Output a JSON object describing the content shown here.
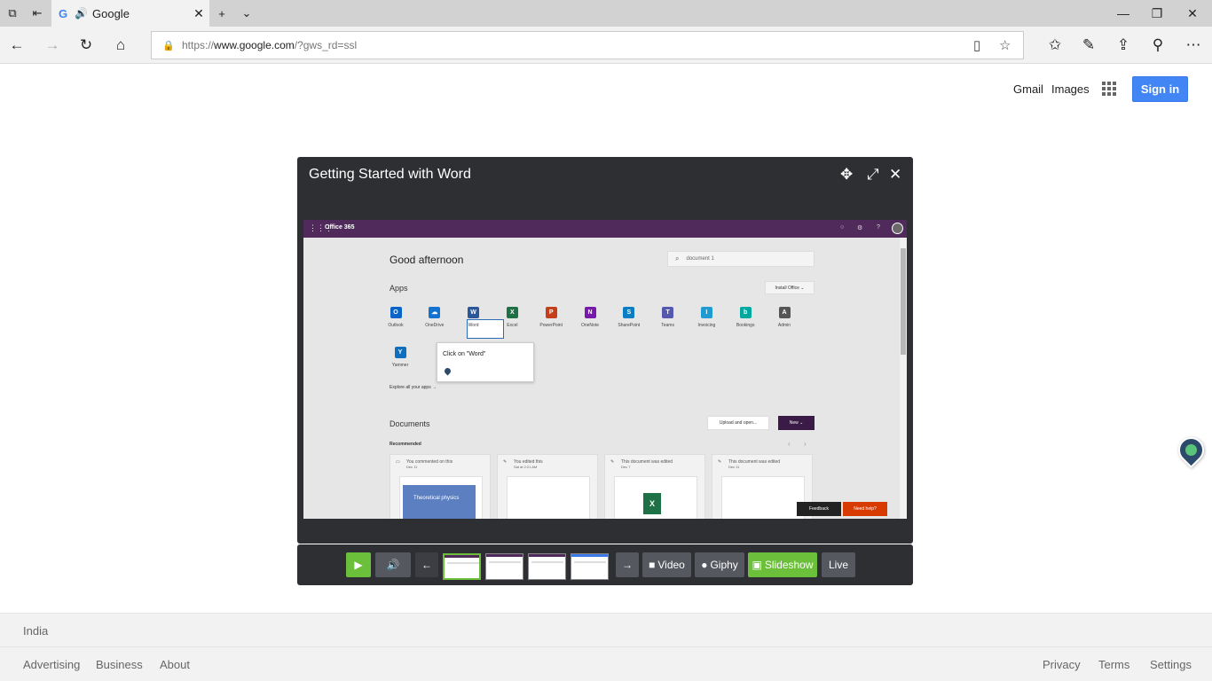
{
  "browser": {
    "tab_title": "Google",
    "url_scheme": "https://",
    "url_host": "www.google.com",
    "url_path": "/?gws_rd=ssl"
  },
  "google": {
    "gmail": "Gmail",
    "images": "Images",
    "sign_in": "Sign in"
  },
  "modal": {
    "title": "Getting Started with Word",
    "office": {
      "brand": "Office 365",
      "greeting": "Good afternoon",
      "search_placeholder": "document 1",
      "apps_heading": "Apps",
      "install_label": "Install Office ⌄",
      "apps": [
        {
          "label": "Outlook",
          "glyph": "O",
          "color": "#0a64c8"
        },
        {
          "label": "OneDrive",
          "glyph": "☁",
          "color": "#1473d0"
        },
        {
          "label": "Word",
          "glyph": "W",
          "color": "#2b579a"
        },
        {
          "label": "Excel",
          "glyph": "X",
          "color": "#1e7145"
        },
        {
          "label": "PowerPoint",
          "glyph": "P",
          "color": "#c43e1c"
        },
        {
          "label": "OneNote",
          "glyph": "N",
          "color": "#7719aa"
        },
        {
          "label": "SharePoint",
          "glyph": "S",
          "color": "#0a7ec2"
        },
        {
          "label": "Teams",
          "glyph": "T",
          "color": "#5558af"
        },
        {
          "label": "Invoicing",
          "glyph": "I",
          "color": "#1f9bd1"
        },
        {
          "label": "Bookings",
          "glyph": "b",
          "color": "#00a99d"
        },
        {
          "label": "Admin",
          "glyph": "A",
          "color": "#555555"
        },
        {
          "label": "Yammer",
          "glyph": "Y",
          "color": "#106ebe"
        }
      ],
      "tooltip": "Click on \"Word\"",
      "explore": "Explore all your apps  →",
      "documents_heading": "Documents",
      "upload_label": "Upload and open...",
      "new_label": "New  ⌄",
      "recommended": "Recommended",
      "cards": [
        {
          "head": "You commented on this",
          "date": "Dec 11",
          "thumb_text": "Theoretical physics"
        },
        {
          "head": "You edited this",
          "date": "Sat at 2:21 AM"
        },
        {
          "head": "This document was edited",
          "date": "Dec 7"
        },
        {
          "head": "This document was edited",
          "date": "Dec 11"
        }
      ],
      "feedback": "Feedback",
      "need_help": "Need help?"
    }
  },
  "controls": {
    "video": "Video",
    "giphy": "Giphy",
    "slideshow": "Slideshow",
    "live": "Live"
  },
  "footer": {
    "country": "India",
    "left_links": [
      "Advertising",
      "Business",
      "About"
    ],
    "right_links": [
      "Privacy",
      "Terms",
      "Settings"
    ]
  },
  "colors": {
    "accent_green": "#6cbf3a",
    "signin_blue": "#4285f4",
    "office_purple": "#512a5c"
  }
}
